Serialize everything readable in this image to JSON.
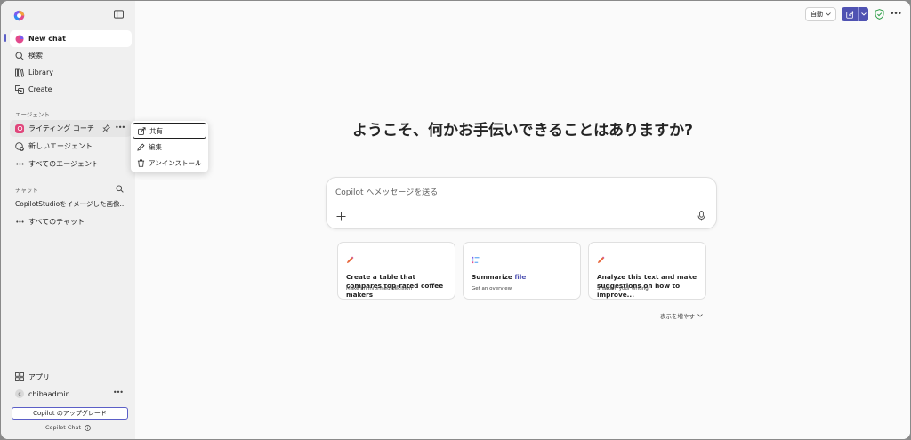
{
  "sidebar": {
    "nav": [
      {
        "label": "New chat",
        "icon": "copilot-chat-icon"
      },
      {
        "label": "検索",
        "icon": "search-icon"
      },
      {
        "label": "Library",
        "icon": "library-icon"
      },
      {
        "label": "Create",
        "icon": "create-icon"
      }
    ],
    "agents_label": "エージェント",
    "agent_active": "ライティング コーチ",
    "new_agent": "新しいエージェント",
    "all_agents": "すべてのエージェント",
    "chats_label": "チャット",
    "recent_chat": "CopilotStudioをイメージした画像...",
    "all_chats": "すべてのチャット",
    "apps": "アプリ",
    "user_initial": "c",
    "user_name": "chibaadmin",
    "upgrade": "Copilot のアップグレード",
    "brand": "Copilot Chat"
  },
  "context_menu": {
    "items": [
      {
        "label": "共有",
        "icon": "share-icon"
      },
      {
        "label": "編集",
        "icon": "pencil-icon"
      },
      {
        "label": "アンインストール",
        "icon": "trash-icon"
      }
    ]
  },
  "header": {
    "mode": "自動"
  },
  "main": {
    "headline": "ようこそ、何かお手伝いできることはありますか?",
    "composer_placeholder": "Copilot へメッセージを送る",
    "cards": [
      {
        "title": "Create a table that compares top-rated coffee makers",
        "title_accent": "",
        "sub": "Make an informed decision"
      },
      {
        "title": "Summarize ",
        "title_accent": "file",
        "sub": "Get an overview"
      },
      {
        "title": "Analyze this text and make suggestions on how to improve...",
        "title_accent": "",
        "sub": "Sharpen your writing"
      }
    ],
    "show_more": "表示を増やす"
  },
  "colors": {
    "accent": "#4f52b2",
    "agent_badge": "#e0457b",
    "shield": "#2e9e47"
  }
}
